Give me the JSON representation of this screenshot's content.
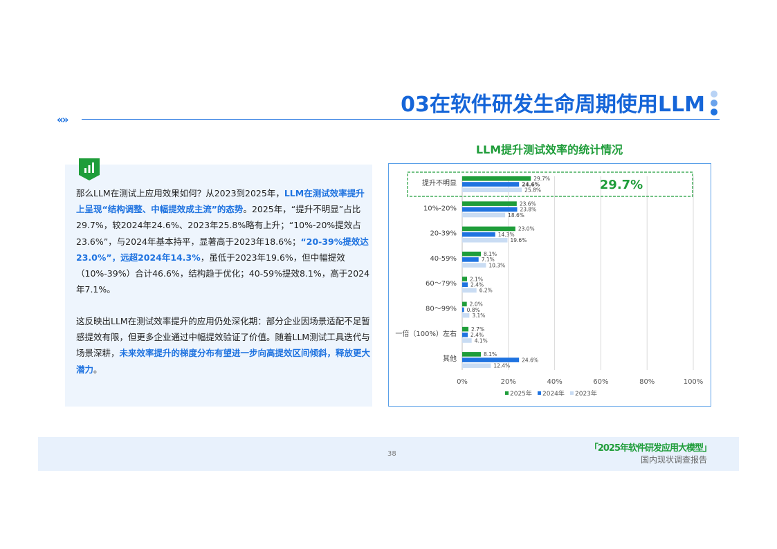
{
  "header": {
    "title": "03在软件研发生命周期使用LLM"
  },
  "text": {
    "p1_a": "那么LLM在测试上应用效果如何？从2023到2025年，",
    "p1_b": "LLM在测试效率提升上呈现“结构调整、中幅提效成主流”的态势",
    "p1_c": "。2025年，“提升不明显”占比29.7%，较2024年24.6%、2023年25.8%略有上升；“10%-20%提效占23.6%”，与2024年基本持平，显著高于2023年18.6%；",
    "p1_d": "“20-39%提效达23.0%”，远超2024年14.3%",
    "p1_e": "，虽低于2023年19.6%，但中幅提效（10%-39%）合计46.6%，结构趋于优化；40-59%提效8.1%，高于2024年7.1%。",
    "p2_a": "这反映出LLM在测试效率提升的应用仍处深化期：部分企业因场景适配不足暂感提效有限，但更多企业通过中幅提效验证了价值。随着LLM测试工具迭代与场景深耕，",
    "p2_b": "未来效率提升的梯度分布有望进一步向高提效区间倾斜，释放更大潜力",
    "p2_c": "。"
  },
  "footer": {
    "page": "38",
    "report_title": "「2025年软件研发应用大模型」",
    "report_sub": "国内现状调查报告"
  },
  "colors": {
    "s2025": "#1f9d3a",
    "s2024": "#1f73e0",
    "s2023": "#c9dcf3",
    "title_blue": "#1565d8",
    "green": "#1f9d3a"
  },
  "chart_data": {
    "type": "bar",
    "orientation": "horizontal",
    "title": "LLM提升测试效率的统计情况",
    "categories": [
      "提升不明显",
      "10%-20%",
      "20-39%",
      "40-59%",
      "60～79%",
      "80～99%",
      "一倍（100%）左右",
      "其他"
    ],
    "series": [
      {
        "name": "2025年",
        "values": [
          29.7,
          23.6,
          23.0,
          8.1,
          2.1,
          2.0,
          2.7,
          8.1
        ]
      },
      {
        "name": "2024年",
        "values": [
          24.6,
          23.8,
          14.3,
          7.1,
          2.4,
          0.8,
          2.4,
          24.6
        ]
      },
      {
        "name": "2023年",
        "values": [
          25.8,
          18.6,
          19.6,
          10.3,
          6.2,
          3.1,
          4.1,
          12.4
        ]
      }
    ],
    "x_ticks": [
      "0%",
      "20%",
      "40%",
      "60%",
      "80%",
      "100%"
    ],
    "xlim": [
      0,
      100
    ],
    "grid": true,
    "legend": "bottom",
    "highlight": {
      "category": "提升不明显",
      "label": "29.7%"
    }
  }
}
